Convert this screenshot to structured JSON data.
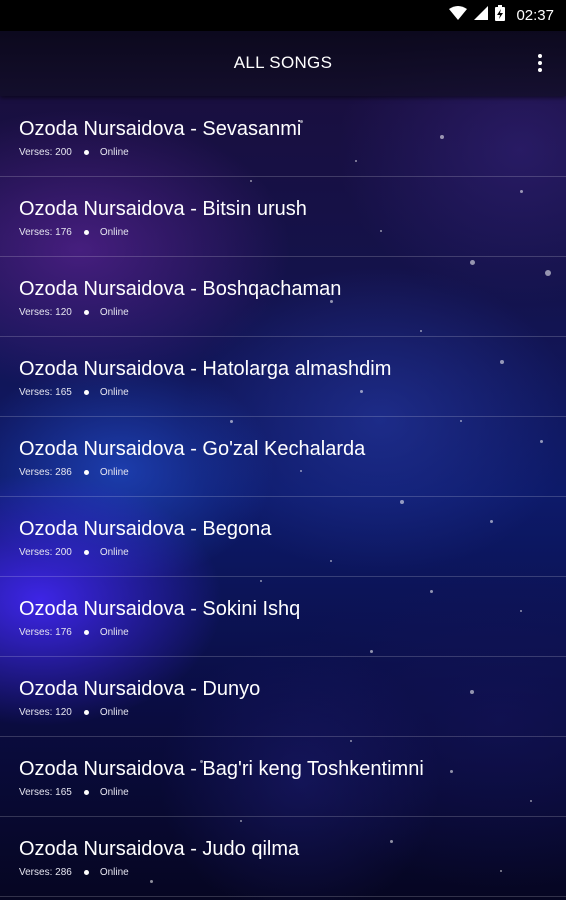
{
  "status_bar": {
    "time": "02:37",
    "icons": [
      "wifi-icon",
      "cellular-signal-icon",
      "battery-charging-icon"
    ]
  },
  "app_bar": {
    "title": "ALL SONGS",
    "overflow_icon": "more-vert-icon"
  },
  "songs": [
    {
      "title": "Ozoda Nursaidova - Sevasanmi",
      "verses": "Verses: 200",
      "status": "Online"
    },
    {
      "title": "Ozoda Nursaidova - Bitsin urush",
      "verses": "Verses: 176",
      "status": "Online"
    },
    {
      "title": "Ozoda Nursaidova - Boshqachaman",
      "verses": "Verses: 120",
      "status": "Online"
    },
    {
      "title": "Ozoda Nursaidova - Hatolarga almashdim",
      "verses": "Verses: 165",
      "status": "Online"
    },
    {
      "title": "Ozoda Nursaidova - Go'zal Kechalarda",
      "verses": "Verses: 286",
      "status": "Online"
    },
    {
      "title": "Ozoda Nursaidova - Begona",
      "verses": "Verses: 200",
      "status": "Online"
    },
    {
      "title": "Ozoda Nursaidova - Sokini Ishq",
      "verses": "Verses: 176",
      "status": "Online"
    },
    {
      "title": "Ozoda Nursaidova - Dunyo",
      "verses": "Verses: 120",
      "status": "Online"
    },
    {
      "title": "Ozoda Nursaidova - Bag'ri keng Toshkentimni",
      "verses": "Verses: 165",
      "status": "Online"
    },
    {
      "title": "Ozoda Nursaidova - Judo qilma",
      "verses": "Verses: 286",
      "status": "Online"
    }
  ],
  "colors": {
    "status_bar_bg": "#000000",
    "text": "#ffffff",
    "background_accent": "#2b3bd6"
  }
}
